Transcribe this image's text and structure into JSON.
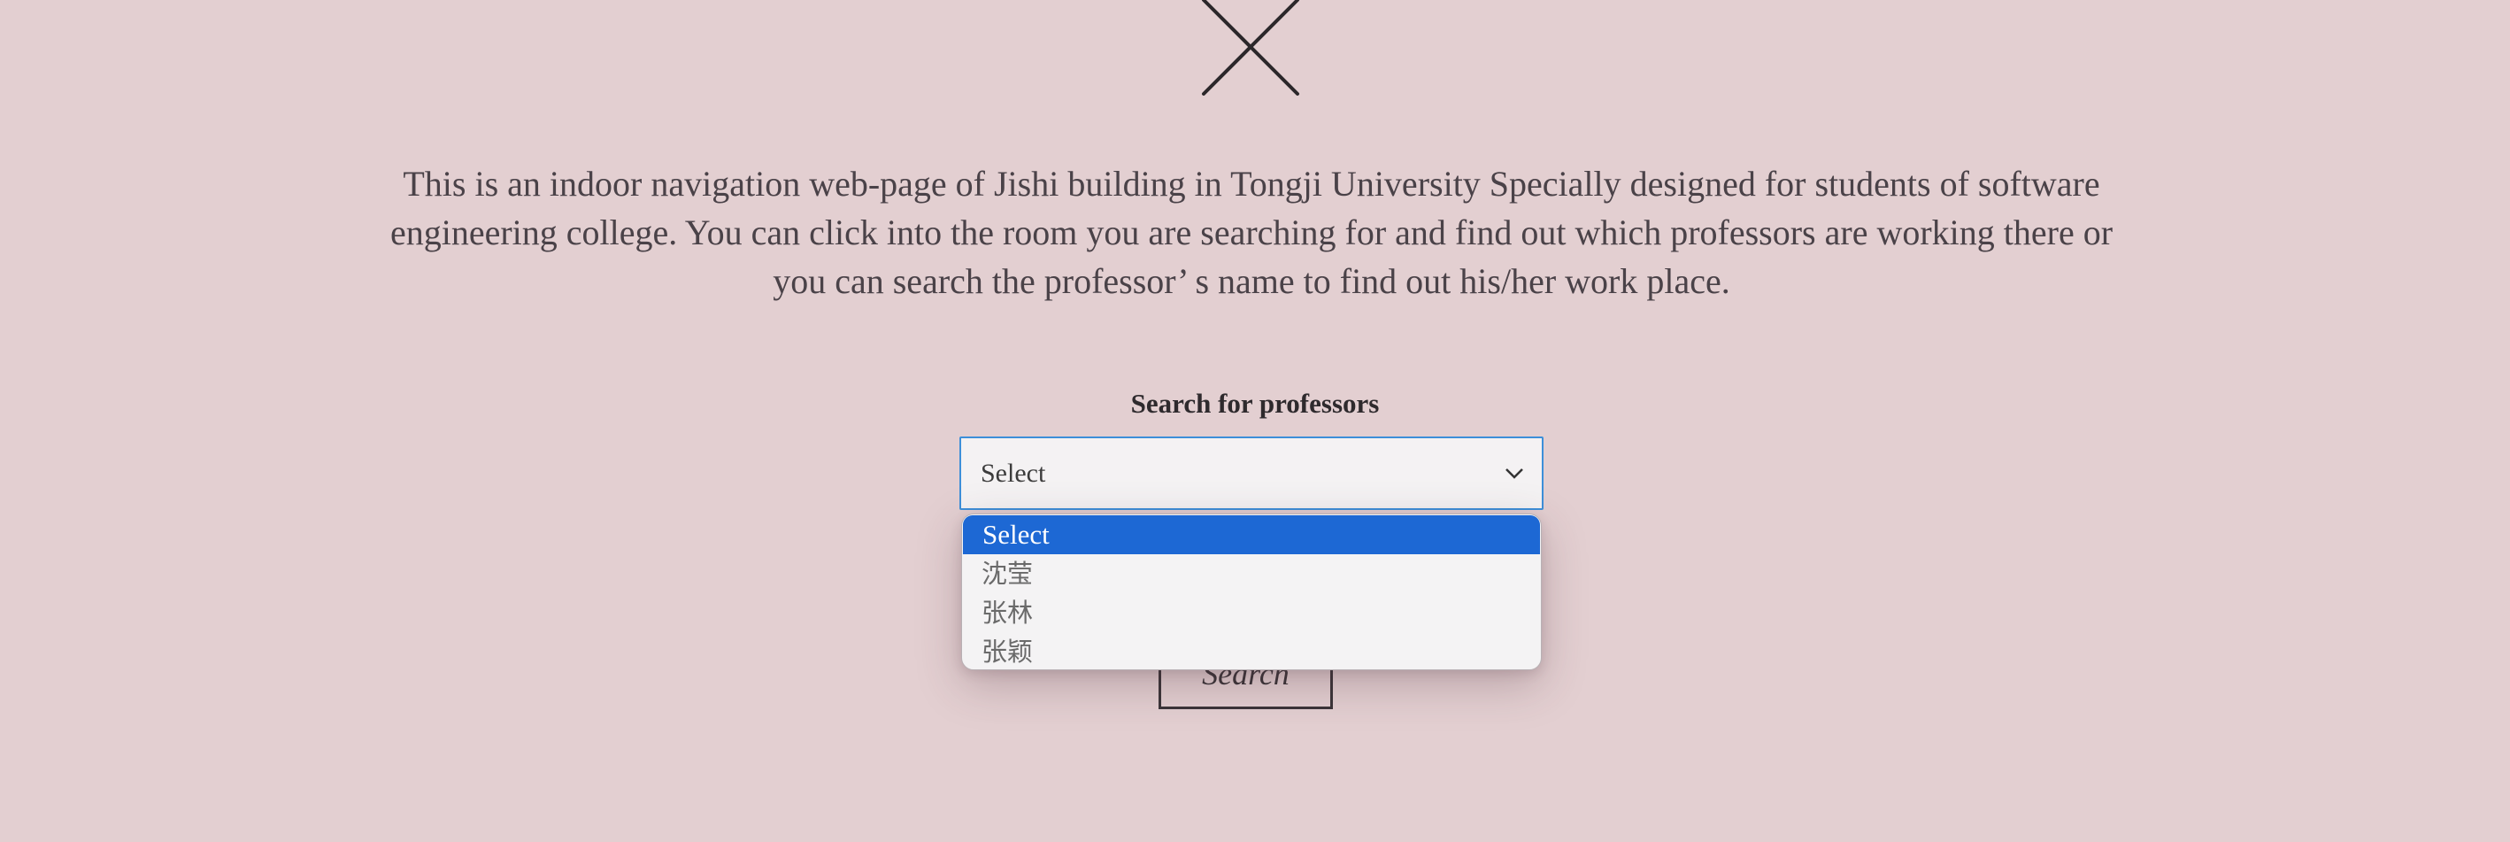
{
  "page": {
    "close_icon": "close-x-icon",
    "intro_lines": [
      "This is an indoor navigation web-page of Jishi building in Tongji University Specially designed for students of software",
      "engineering college. You can click into the room you are searching for and find out which professors are working there or",
      "you can search the professor’ s name to find out his/her work place."
    ]
  },
  "search": {
    "label": "Search for professors",
    "select_value": "Select",
    "options": [
      "Select",
      "沈莹",
      "张林",
      "张颖"
    ],
    "selected_index": 0,
    "button_label": "Search"
  },
  "colors": {
    "background": "#e3cfd1",
    "select_border": "#3d8fd9",
    "option_highlight": "#1d68d4",
    "text": "#3a3438"
  }
}
